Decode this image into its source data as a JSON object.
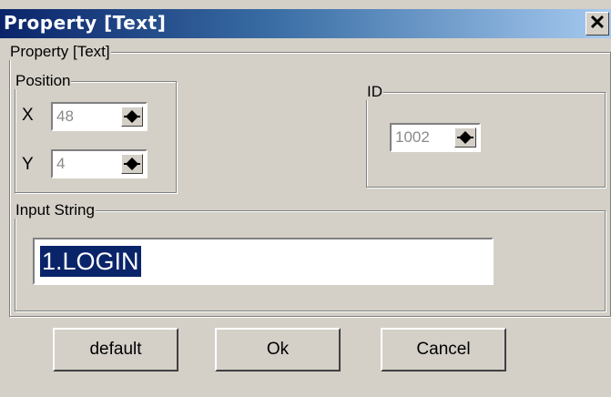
{
  "window": {
    "title": "Property  [Text]",
    "close_glyph": "✕"
  },
  "outer_group": {
    "label": "Property  [Text]"
  },
  "position": {
    "label": "Position",
    "x_label": "X",
    "x_value": "48",
    "y_label": "Y",
    "y_value": "4"
  },
  "id": {
    "label": "ID",
    "value": "1002"
  },
  "input_string": {
    "label": "Input String",
    "value": "1.LOGIN"
  },
  "buttons": {
    "default": "default",
    "ok": "Ok",
    "cancel": "Cancel"
  },
  "colors": {
    "title_bar": "#0a246a",
    "dialog_bg": "#d4d0c8",
    "selection": "#0a246a"
  }
}
